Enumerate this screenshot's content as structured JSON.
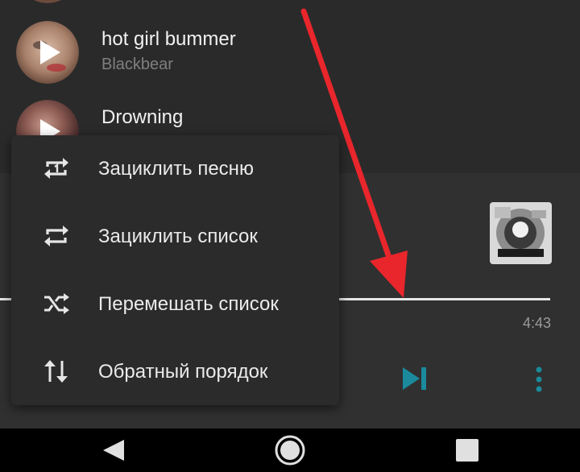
{
  "songs": [
    {
      "title": "hot girl bummer",
      "artist": "Blackbear",
      "thumb_icon": "play-icon"
    },
    {
      "title": "Drowning",
      "artist": "",
      "thumb_icon": "play-icon"
    }
  ],
  "player": {
    "duration": "4:43",
    "progress_fraction": 1.0,
    "accent_color": "#1a8a9c",
    "next_icon": "skip-next-icon",
    "more_icon": "more-vertical-icon"
  },
  "menu": {
    "items": [
      {
        "label": "Зациклить песню",
        "icon": "repeat-one-icon"
      },
      {
        "label": "Зациклить список",
        "icon": "repeat-icon"
      },
      {
        "label": "Перемешать список",
        "icon": "shuffle-icon"
      },
      {
        "label": "Обратный порядок",
        "icon": "swap-vertical-icon"
      }
    ]
  },
  "annotation": {
    "color": "#e8262c"
  },
  "nav": {
    "back_icon": "back-icon",
    "home_icon": "home-icon",
    "recents_icon": "recents-icon"
  }
}
